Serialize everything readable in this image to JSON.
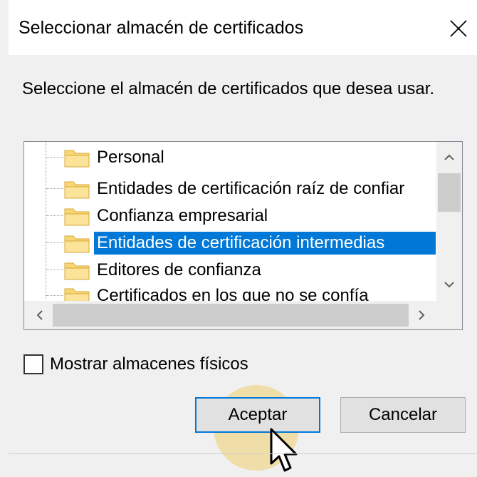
{
  "dialog": {
    "title": "Seleccionar almacén de certificados",
    "instruction": "Seleccione el almacén de certificados que desea usar."
  },
  "stores": [
    {
      "label": "Personal",
      "selected": false
    },
    {
      "label": "Entidades de certificación raíz de confiar",
      "selected": false
    },
    {
      "label": "Confianza empresarial",
      "selected": false
    },
    {
      "label": "Entidades de certificación intermedias",
      "selected": true
    },
    {
      "label": "Editores de confianza",
      "selected": false
    },
    {
      "label": "Certificados en los que no se confía",
      "selected": false
    }
  ],
  "checkbox": {
    "label": "Mostrar almacenes físicos",
    "checked": false
  },
  "buttons": {
    "ok": "Aceptar",
    "cancel": "Cancelar"
  },
  "colors": {
    "selection": "#0078d7",
    "focus_border": "#0078d7",
    "click_highlight": "#f0c850"
  },
  "icons": {
    "close": "close-icon",
    "folder": "folder-icon",
    "cursor": "mouse-pointer-icon"
  }
}
